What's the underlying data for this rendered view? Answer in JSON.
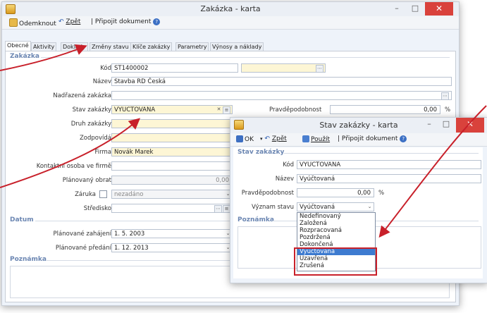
{
  "colors": {
    "accent": "#6b86b2",
    "highlight_box": "#c8202a",
    "selection": "#3d7bd0",
    "required_field": "#fdf6d5"
  },
  "main_window": {
    "title": "Zakázka - karta",
    "toolbar": {
      "cancel": "Odemknout",
      "back": "Zpět",
      "attach": "Připojit dokument"
    },
    "tabs": [
      "Obecné",
      "Aktivity",
      "Doklady",
      "Změny stavu",
      "Klíče zakázky",
      "Parametry",
      "Výnosy a náklady"
    ],
    "section_zakazka": "Zakázka",
    "labels": {
      "kod": "Kód",
      "nazev": "Název",
      "nadrazena": "Nadřazená zakázka",
      "stav": "Stav zakázky",
      "druh": "Druh zakázky",
      "zodpovida": "Zodpovídá",
      "firma": "Firma",
      "kontakt": "Kontaktní osoba ve firmě",
      "obrat": "Plánovaný obrat",
      "zaruka": "Záruka",
      "stredisko": "Středisko",
      "pravdepodobnost": "Pravděpodobnost"
    },
    "values": {
      "kod": "ST1400002",
      "nazev": "Stavba RD Česká",
      "stav": "VYUCTOVANA",
      "firma": "Novák Marek",
      "obrat": "0,00",
      "zaruka": "nezadáno",
      "pravdepodobnost": "0,00",
      "percent": "%"
    },
    "section_datum": "Datum",
    "dates": {
      "zahajeni_label": "Plánované zahájení",
      "zahajeni": "1. 5. 2003",
      "predani_label": "Plánované předání",
      "predani": "1. 12. 2013"
    },
    "section_poznamka": "Poznámka"
  },
  "dialog": {
    "title": "Stav zakázky - karta",
    "toolbar": {
      "ok": "OK",
      "back": "Zpět",
      "apply": "Použít",
      "attach": "Připojit dokument"
    },
    "section": "Stav zakázky",
    "labels": {
      "kod": "Kód",
      "nazev": "Název",
      "pravdepodobnost": "Pravděpodobnost",
      "vyznam": "Význam stavu"
    },
    "values": {
      "kod": "VYUCTOVANA",
      "nazev": "Vyúčtovaná",
      "pravdepodobnost": "0,00",
      "percent": "%",
      "vyznam": "Vyúčtovaná"
    },
    "section_poznamka": "Poznámka",
    "options": [
      "Nedefinovaný",
      "Založená",
      "Rozpracovaná",
      "Pozdržená",
      "Dokončená",
      "Vyúčtovaná",
      "Uzavřená",
      "Zrušená"
    ],
    "selected_option": "Vyúčtovaná"
  }
}
